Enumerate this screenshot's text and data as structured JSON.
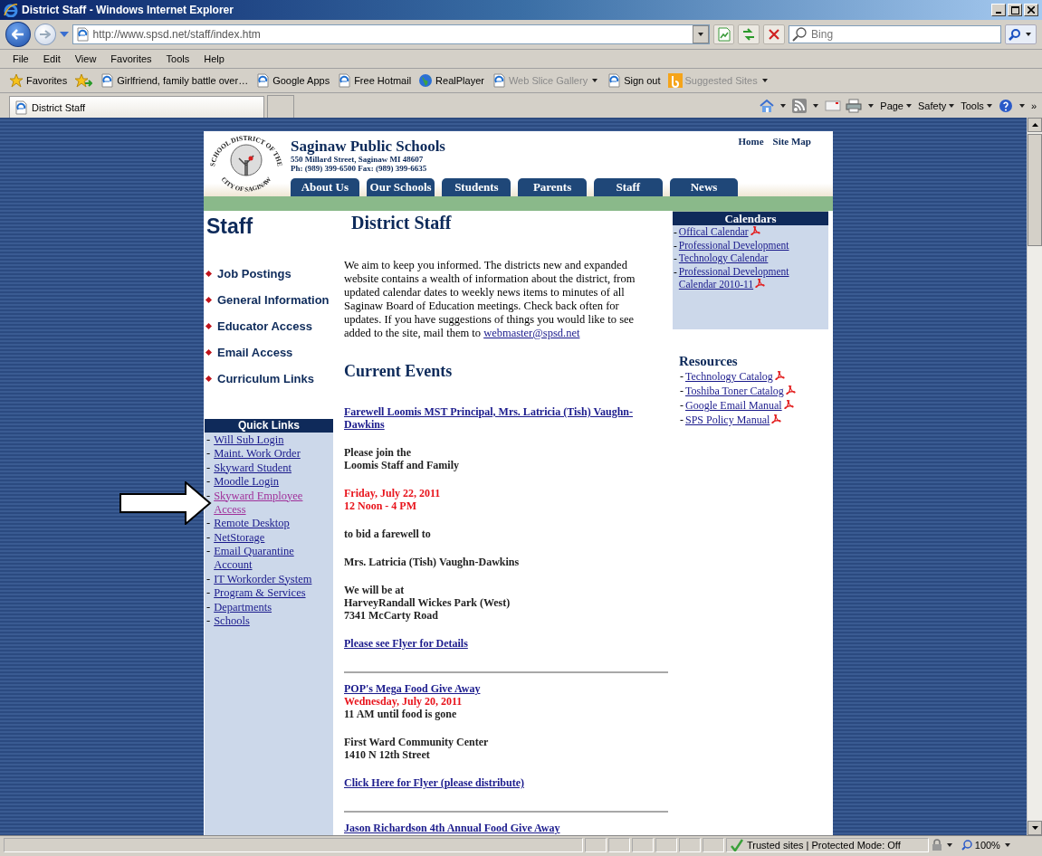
{
  "window": {
    "title": "District Staff - Windows Internet Explorer"
  },
  "address_bar": {
    "url": "http://www.spsd.net/staff/index.htm"
  },
  "search": {
    "placeholder": "Bing"
  },
  "menu": [
    "File",
    "Edit",
    "View",
    "Favorites",
    "Tools",
    "Help"
  ],
  "favorites_bar": {
    "label": "Favorites",
    "items": [
      {
        "label": "Girlfriend, family battle over…",
        "kind": "page",
        "disabled": false,
        "dropdown": false
      },
      {
        "label": "Google Apps",
        "kind": "page",
        "disabled": false,
        "dropdown": false
      },
      {
        "label": "Free Hotmail",
        "kind": "page",
        "disabled": false,
        "dropdown": false
      },
      {
        "label": "RealPlayer",
        "kind": "globe",
        "disabled": false,
        "dropdown": false
      },
      {
        "label": "Web Slice Gallery",
        "kind": "page",
        "disabled": true,
        "dropdown": true
      },
      {
        "label": "Sign out",
        "kind": "page",
        "disabled": false,
        "dropdown": false
      },
      {
        "label": "Suggested Sites",
        "kind": "bing",
        "disabled": true,
        "dropdown": true
      }
    ]
  },
  "tab": {
    "label": "District Staff"
  },
  "command_bar": {
    "items": [
      "Page",
      "Safety",
      "Tools"
    ],
    "overflow": "»"
  },
  "page": {
    "header": {
      "logo_top": "SCHOOL DISTRICT OF THE",
      "logo_bottom": "CITY OF SAGINAW",
      "name": "Saginaw Public Schools",
      "address": "550 Millard Street, Saginaw MI 48607",
      "phone": "Ph: (989) 399-6500  Fax: (989) 399-6635",
      "top_links": [
        "Home",
        "Site Map"
      ],
      "nav_tabs": [
        "About Us",
        "Our Schools",
        "Students",
        "Parents",
        "Staff",
        "News"
      ]
    },
    "left": {
      "heading": "Staff",
      "links": [
        "Job Postings",
        "General Information",
        "Educator Access",
        "Email Access",
        "Curriculum Links"
      ],
      "quick_links": {
        "title": "Quick Links",
        "marker": "-",
        "items": [
          {
            "label": "Will Sub Login",
            "visited": false
          },
          {
            "label": "Maint. Work Order",
            "visited": false
          },
          {
            "label": "Skyward Student",
            "visited": false
          },
          {
            "label": "Moodle Login",
            "visited": false
          },
          {
            "label": "Skyward Employee Access",
            "visited": true
          },
          {
            "label": "Remote Desktop",
            "visited": false
          },
          {
            "label": "NetStorage",
            "visited": false
          },
          {
            "label": "Email Quarantine Account",
            "visited": false
          },
          {
            "label": "IT Workorder System",
            "visited": false
          },
          {
            "label": "Program & Services",
            "visited": false
          },
          {
            "label": "Departments",
            "visited": false
          },
          {
            "label": "Schools",
            "visited": false
          }
        ]
      }
    },
    "main": {
      "heading": "District Staff",
      "intro": "We aim to keep you informed. The districts new and expanded website contains a wealth of information about the district, from updated calendar dates to weekly news items to minutes of all Saginaw Board of Education meetings. Check back often for updates. If you have suggestions of things you would like to see added to the site, mail them to",
      "intro_link": "webmaster@spsd.net",
      "events_heading": "Current Events",
      "events": [
        {
          "paragraphs": [
            [
              {
                "kind": "link",
                "text": "Farewell Loomis MST Principal, Mrs. Latricia (Tish) Vaughn-Dawkins"
              }
            ],
            [
              {
                "kind": "text",
                "text": "Please join the"
              },
              {
                "kind": "text",
                "text": "Loomis Staff and Family"
              }
            ],
            [
              {
                "kind": "date",
                "text": "Friday, July 22, 2011"
              },
              {
                "kind": "date",
                "text": "12 Noon - 4 PM"
              }
            ],
            [
              {
                "kind": "text",
                "text": "to bid a farewell to"
              }
            ],
            [
              {
                "kind": "text",
                "text": "Mrs. Latricia (Tish) Vaughn-Dawkins"
              }
            ],
            [
              {
                "kind": "text",
                "text": "We will be at"
              },
              {
                "kind": "text",
                "text": "HarveyRandall Wickes Park (West)"
              },
              {
                "kind": "text",
                "text": "7341 McCarty Road"
              }
            ],
            [
              {
                "kind": "link",
                "text": "Please see Flyer for Details"
              }
            ]
          ]
        },
        {
          "paragraphs": [
            [
              {
                "kind": "link",
                "text": "POP's Mega Food Give Away"
              },
              {
                "kind": "date",
                "text": "Wednesday, July 20, 2011"
              },
              {
                "kind": "text",
                "text": "11 AM until food is gone"
              }
            ],
            [
              {
                "kind": "text",
                "text": "First Ward Community Center"
              },
              {
                "kind": "text",
                "text": "1410 N 12th Street"
              }
            ],
            [
              {
                "kind": "link",
                "text": "Click Here for Flyer (please distribute)"
              }
            ]
          ]
        },
        {
          "paragraphs": [
            [
              {
                "kind": "link",
                "text": "Jason Richardson 4th Annual Food Give Away"
              }
            ]
          ]
        }
      ]
    },
    "right": {
      "calendars": {
        "title": "Calendars",
        "marker": "-",
        "items": [
          {
            "label": "Offical Calendar",
            "pdf": true
          },
          {
            "label": "Professional Development",
            "pdf": false
          },
          {
            "label": "Technology Calendar",
            "pdf": false
          },
          {
            "label": "Professional Development Calendar 2010-11",
            "pdf": true
          }
        ]
      },
      "resources": {
        "title": "Resources",
        "marker": "-",
        "items": [
          {
            "label": "Technology Catalog",
            "pdf": true
          },
          {
            "label": "Toshiba Toner Catalog",
            "pdf": true
          },
          {
            "label": "Google Email Manual",
            "pdf": true
          },
          {
            "label": "SPS Policy Manual",
            "pdf": true
          }
        ]
      }
    }
  },
  "status_bar": {
    "zone": "Trusted sites | Protected Mode: Off",
    "zoom": "100%"
  }
}
